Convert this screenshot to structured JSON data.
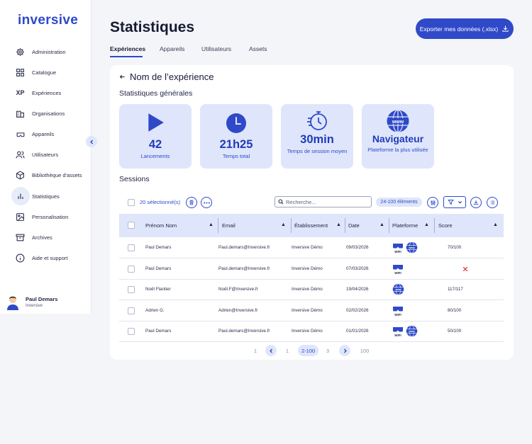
{
  "app": {
    "logo": "inversive"
  },
  "sidebar": {
    "items": [
      {
        "label": "Administration",
        "icon": "gear-icon"
      },
      {
        "label": "Catalogue",
        "icon": "grid-icon"
      },
      {
        "label": "Expériences",
        "icon": "xp-icon",
        "icon_text": "XP"
      },
      {
        "label": "Organisations",
        "icon": "building-icon"
      },
      {
        "label": "Appareils",
        "icon": "vr-headset-icon"
      },
      {
        "label": "Utilisateurs",
        "icon": "users-icon"
      },
      {
        "label": "Bibliothèque d'assets",
        "icon": "cube-icon"
      },
      {
        "label": "Statistiques",
        "icon": "bar-chart-icon",
        "active": true
      },
      {
        "label": "Personalisation",
        "icon": "image-icon"
      },
      {
        "label": "Archives",
        "icon": "archive-icon"
      },
      {
        "label": "Aide et support",
        "icon": "info-icon"
      }
    ],
    "user": {
      "name": "Paul Demars",
      "org": "Inversive"
    }
  },
  "header": {
    "title": "Statistiques",
    "export_label": "Exporter mes données (.xlsx)",
    "tabs": [
      "Expériences",
      "Appareils",
      "Utilisateurs",
      "Assets"
    ],
    "active_tab": "Expériences"
  },
  "experience": {
    "back_label": "Nom de l’expérience",
    "general_title": "Statistiques générales",
    "stats": [
      {
        "value": "42",
        "label": "Lancements",
        "icon": "play-icon"
      },
      {
        "value": "21h25",
        "label": "Temps total",
        "icon": "clock-icon"
      },
      {
        "value": "30min",
        "label": "Temps de session moyen",
        "icon": "stopwatch-icon"
      },
      {
        "value": "Navigateur",
        "label": "Plateforme la plus utilisée",
        "icon": "www-globe-icon"
      }
    ],
    "sessions_title": "Sessions"
  },
  "toolbar": {
    "selected_label": "20 sélectionné(s)",
    "search_placeholder": "Recherche...",
    "count_label": "24-100 éléments"
  },
  "table": {
    "columns": [
      "Prénom Nom",
      "Email",
      "Établissement",
      "Date",
      "Plateforme",
      "Score"
    ],
    "rows": [
      {
        "name": "Paul Demars",
        "email": "Paul.demars@Inversive.fr",
        "org": "Inversive Démo",
        "date": "09/03/2026",
        "platforms": [
          "vr-wifi",
          "www"
        ],
        "score": "70/100"
      },
      {
        "name": "Paul Demars",
        "email": "Paul.demars@Inversive.fr",
        "org": "Inversive Démo",
        "date": "07/03/2026",
        "platforms": [
          "vr-wifi"
        ],
        "score": "",
        "score_failed": true
      },
      {
        "name": "Noël Flantier",
        "email": "Noël.F@Inversive.fr",
        "org": "Inversive Démo",
        "date": "19/04/2026",
        "platforms": [
          "www"
        ],
        "score": "117/117"
      },
      {
        "name": "Adrien G.",
        "email": "Adrien@Inversive.fr",
        "org": "Inversive Démo",
        "date": "02/02/2026",
        "platforms": [
          "vr-wifi"
        ],
        "score": "80/100"
      },
      {
        "name": "Paul Demars",
        "email": "Paul.demars@Inversive.fr",
        "org": "Inversive Démo",
        "date": "01/01/2026",
        "platforms": [
          "vr-wifi",
          "www"
        ],
        "score": "50/100"
      }
    ]
  },
  "pagination": {
    "first": "1",
    "prev_page": "1",
    "current": "2-100",
    "next_page": "3",
    "last": "100"
  },
  "colors": {
    "accent": "#2f49c9",
    "accent_light": "#dfe6fb",
    "error": "#e03a3a"
  }
}
